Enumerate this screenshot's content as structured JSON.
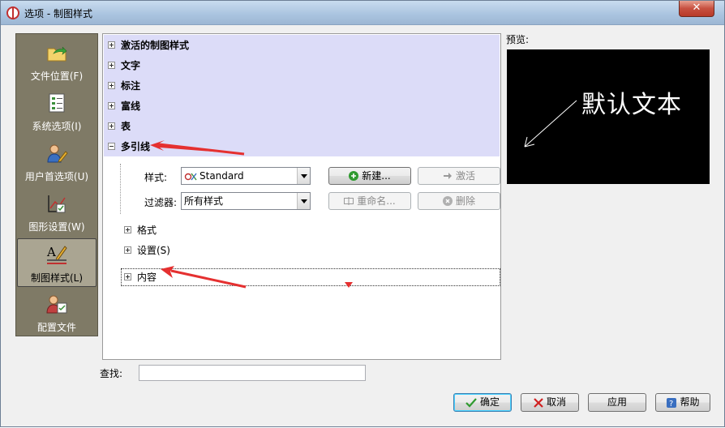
{
  "window": {
    "title": "选项 - 制图样式",
    "close_label": "✕"
  },
  "sidebar": {
    "items": [
      {
        "label": "文件位置(F)",
        "icon": "folder-arrow-icon"
      },
      {
        "label": "系统选项(I)",
        "icon": "checklist-icon"
      },
      {
        "label": "用户首选项(U)",
        "icon": "user-pencil-icon"
      },
      {
        "label": "图形设置(W)",
        "icon": "graphics-settings-icon"
      },
      {
        "label": "制图样式(L)",
        "icon": "drafting-style-icon",
        "active": true
      },
      {
        "label": "配置文件",
        "icon": "profile-icon"
      }
    ]
  },
  "tree": {
    "categories": [
      "激活的制图样式",
      "文字",
      "标注",
      "富线",
      "表",
      "多引线"
    ],
    "expanded_category": "多引线",
    "style_label": "样式:",
    "style_value": "Standard",
    "filter_label": "过滤器:",
    "filter_value": "所有样式",
    "buttons": {
      "new": "新建...",
      "activate": "激活",
      "rename": "重命名...",
      "delete": "删除"
    },
    "subitems": [
      "格式",
      "设置(S)",
      "内容"
    ]
  },
  "preview": {
    "label": "预览:",
    "text": "默认文本"
  },
  "search": {
    "label": "查找:",
    "value": ""
  },
  "footer": {
    "ok": "确定",
    "cancel": "取消",
    "apply": "应用",
    "help": "帮助"
  },
  "colors": {
    "highlight": "#dcdcf8",
    "sidebar_bg": "#7f7a66",
    "annotation_red": "#e53030"
  }
}
